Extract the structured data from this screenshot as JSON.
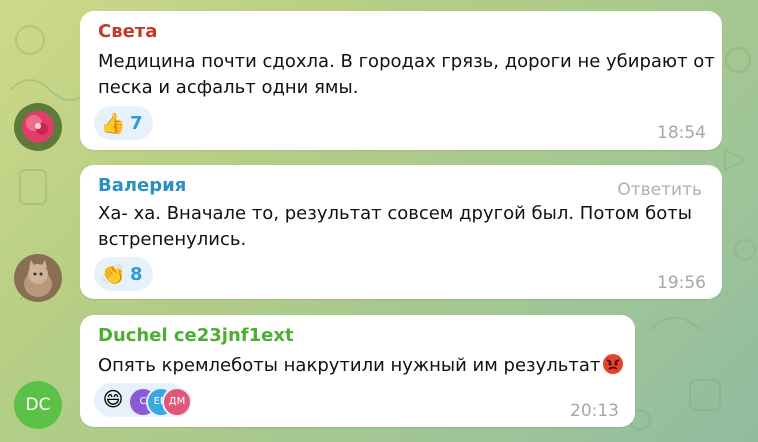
{
  "messages": [
    {
      "sender": "Света",
      "sender_color": "#c0392b",
      "lines": [
        "Медицина почти сдохла. В городах грязь, дороги не убирают от",
        "песка и асфальт одни ямы."
      ],
      "reaction": {
        "icon": "thumbs-up-icon",
        "count": "7"
      },
      "time": "18:54"
    },
    {
      "sender": "Валерия",
      "sender_color": "#2b8fc4",
      "reply_label": "Ответить",
      "lines": [
        "Ха- ха. Вначале то, результат совсем другой был. Потом боты",
        "встрепенулись."
      ],
      "reaction": {
        "icon": "clapping-hands-icon",
        "count": "8"
      },
      "time": "19:56"
    },
    {
      "sender": "Duchel ce23jnf1ext",
      "sender_color": "#4caf32",
      "lines": [
        "Опять кремлеботы накрутили нужный им результат"
      ],
      "reaction_avatars": [
        "С",
        "ЕМ",
        "ДМ"
      ],
      "time": "20:13",
      "avatar_initials": "DC"
    }
  ]
}
